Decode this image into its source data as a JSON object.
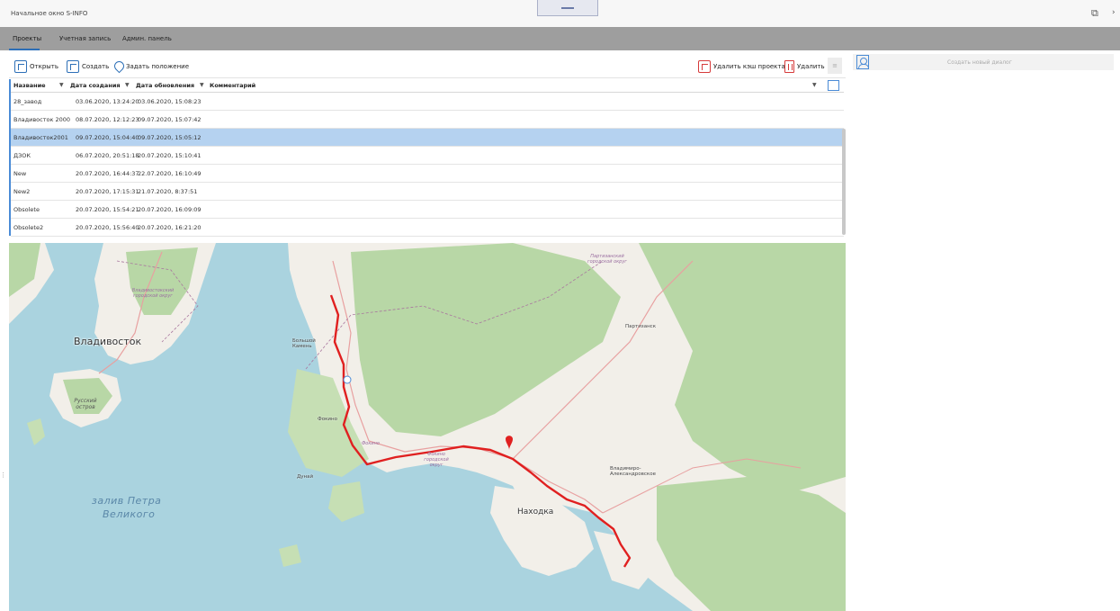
{
  "window": {
    "title": "Начальное окно S-INFO",
    "restore_icon": "restore-icon",
    "close_icon": "close-icon",
    "close_glyph": "›"
  },
  "tabs": [
    {
      "label": "Проекты",
      "active": true
    },
    {
      "label": "Учетная запись",
      "active": false
    },
    {
      "label": "Админ. панель",
      "active": false
    }
  ],
  "toolbar": {
    "open_label": "Открыть",
    "create_label": "Создать",
    "set_position_label": "Задать положение",
    "delete_cache_label": "Удалить кэш проекта",
    "delete_label": "Удалить",
    "more_glyph": "≡"
  },
  "table": {
    "columns": [
      "Название",
      "Дата создания",
      "Дата обновления",
      "Комментарий"
    ],
    "rows": [
      {
        "name": "28_завод",
        "created": "03.06.2020, 13:24:20",
        "updated": "03.06.2020, 15:08:23",
        "comment": ""
      },
      {
        "name": "Владивосток 2000",
        "created": "08.07.2020, 12:12:23",
        "updated": "09.07.2020, 15:07:42",
        "comment": ""
      },
      {
        "name": "Владивосток2001",
        "created": "09.07.2020, 15:04:40",
        "updated": "09.07.2020, 15:05:12",
        "comment": ""
      },
      {
        "name": "ДЗОК",
        "created": "06.07.2020, 20:51:18",
        "updated": "20.07.2020, 15:10:41",
        "comment": ""
      },
      {
        "name": "New",
        "created": "20.07.2020, 16:44:37",
        "updated": "22.07.2020, 16:10:49",
        "comment": ""
      },
      {
        "name": "New2",
        "created": "20.07.2020, 17:15:31",
        "updated": "21.07.2020, 8:37:51",
        "comment": ""
      },
      {
        "name": "Obsolete",
        "created": "20.07.2020, 15:54:21",
        "updated": "20.07.2020, 16:09:09",
        "comment": ""
      },
      {
        "name": "Obsolete2",
        "created": "20.07.2020, 15:56:40",
        "updated": "20.07.2020, 16:21:20",
        "comment": ""
      }
    ],
    "selected_index": 2,
    "filter_glyph": "▼"
  },
  "map": {
    "labels": {
      "vladivostok": "Владивосток",
      "russky": "Русский остров",
      "bolshoy_kamen": "Большой Камень",
      "fokino": "Фокино",
      "partizansk": "Партизанск",
      "nakhodka": "Находка",
      "vladimiro": "Владимиро-Александровское",
      "dunay": "Дунай",
      "zaliv_line1": "залив Петра",
      "zaliv_line2": "Великого",
      "vlad_okrug": "Владивостокский городской округ",
      "partizansk_okrug": "Партизанский городской округ",
      "fokino_small": "Фокино",
      "fokino_okrug": "Фокино городской округ"
    },
    "colors": {
      "water": "#aad3df",
      "land": "#f2efe9",
      "forest": "#b8d7a6",
      "route": "#e02020",
      "road": "#e8a0a0"
    }
  },
  "right_panel": {
    "title": "Создать новый диалог"
  },
  "grip_glyph": "⋮"
}
